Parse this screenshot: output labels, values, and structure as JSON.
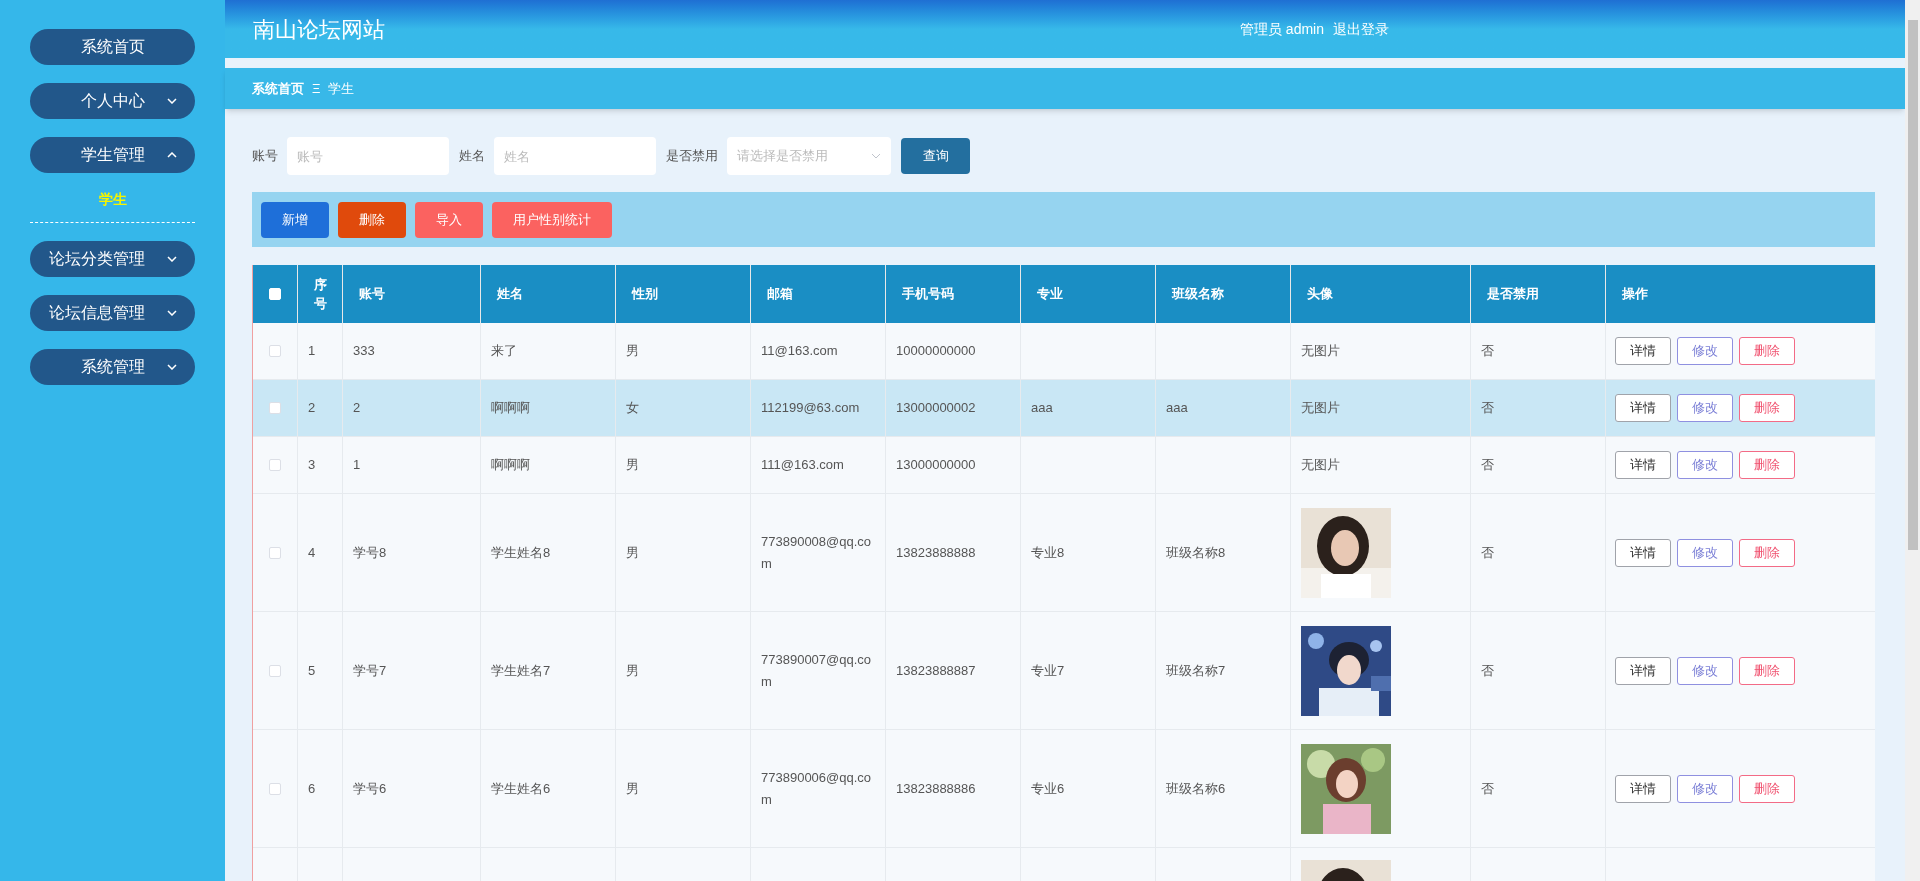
{
  "sidebar": {
    "items": [
      {
        "label": "系统首页",
        "kind": "link"
      },
      {
        "label": "个人中心",
        "kind": "group",
        "expanded": false
      },
      {
        "label": "学生管理",
        "kind": "group",
        "expanded": true,
        "children": [
          {
            "label": "学生",
            "selected": true
          }
        ]
      },
      {
        "label": "论坛分类管理",
        "kind": "group",
        "expanded": false
      },
      {
        "label": "论坛信息管理",
        "kind": "group",
        "expanded": false
      },
      {
        "label": "系统管理",
        "kind": "group",
        "expanded": false
      }
    ]
  },
  "header": {
    "title": "南山论坛网站",
    "user": "管理员 admin",
    "logout": "退出登录"
  },
  "breadcrumb": {
    "home": "系统首页",
    "separator": "Ξ",
    "current": "学生"
  },
  "search": {
    "fields": [
      {
        "label": "账号",
        "placeholder": "账号",
        "kind": "input"
      },
      {
        "label": "姓名",
        "placeholder": "姓名",
        "kind": "input"
      },
      {
        "label": "是否禁用",
        "placeholder": "请选择是否禁用",
        "kind": "select"
      }
    ],
    "button": "查询"
  },
  "toolbar": [
    {
      "label": "新增",
      "color": "#1e6fd9"
    },
    {
      "label": "删除",
      "color": "#e04a0c"
    },
    {
      "label": "导入",
      "color": "#fb6260"
    },
    {
      "label": "用户性别统计",
      "color": "#fb6260"
    }
  ],
  "table": {
    "select_all_checked": false,
    "columns": [
      "序号",
      "账号",
      "姓名",
      "性别",
      "邮箱",
      "手机号码",
      "专业",
      "班级名称",
      "头像",
      "是否禁用",
      "操作"
    ],
    "rows": [
      {
        "selected": false,
        "checked": false,
        "cells": [
          "1",
          "333",
          "来了",
          "男",
          "11@163.com",
          "10000000000",
          null,
          null
        ],
        "avatar": {
          "kind": "text",
          "text": "无图片"
        },
        "disabled": "否",
        "actions": [
          "详情",
          "修改",
          "删除"
        ]
      },
      {
        "selected": true,
        "checked": false,
        "cells": [
          "2",
          "2",
          "啊啊啊",
          "女",
          "112199@63.com",
          "13000000002",
          "aaa",
          "aaa"
        ],
        "avatar": {
          "kind": "text",
          "text": "无图片"
        },
        "disabled": "否",
        "actions": [
          "详情",
          "修改",
          "删除"
        ]
      },
      {
        "selected": false,
        "checked": false,
        "cells": [
          "3",
          "1",
          "啊啊啊",
          "男",
          "111@163.com",
          "13000000000",
          null,
          null
        ],
        "avatar": {
          "kind": "text",
          "text": "无图片"
        },
        "disabled": "否",
        "actions": [
          "详情",
          "修改",
          "删除"
        ]
      },
      {
        "selected": false,
        "checked": false,
        "cells": [
          "4",
          "学号8",
          "学生姓名8",
          "男",
          "773890008@qq.com",
          "13823888888",
          "专业8",
          "班级名称8"
        ],
        "avatar": {
          "kind": "picture"
        },
        "disabled": "否",
        "actions": [
          "详情",
          "修改",
          "删除"
        ]
      },
      {
        "selected": false,
        "checked": false,
        "cells": [
          "5",
          "学号7",
          "学生姓名7",
          "男",
          "773890007@qq.com",
          "13823888887",
          "专业7",
          "班级名称7"
        ],
        "avatar": {
          "kind": "picture"
        },
        "disabled": "否",
        "actions": [
          "详情",
          "修改",
          "删除"
        ]
      },
      {
        "selected": false,
        "checked": false,
        "cells": [
          "6",
          "学号6",
          "学生姓名6",
          "男",
          "773890006@qq.com",
          "13823888886",
          "专业6",
          "班级名称6"
        ],
        "avatar": {
          "kind": "picture"
        },
        "disabled": "否",
        "actions": [
          "详情",
          "修改",
          "删除"
        ]
      },
      {
        "selected": false,
        "cells": [],
        "avatar": {
          "kind": "picture"
        },
        "actions": []
      }
    ]
  }
}
